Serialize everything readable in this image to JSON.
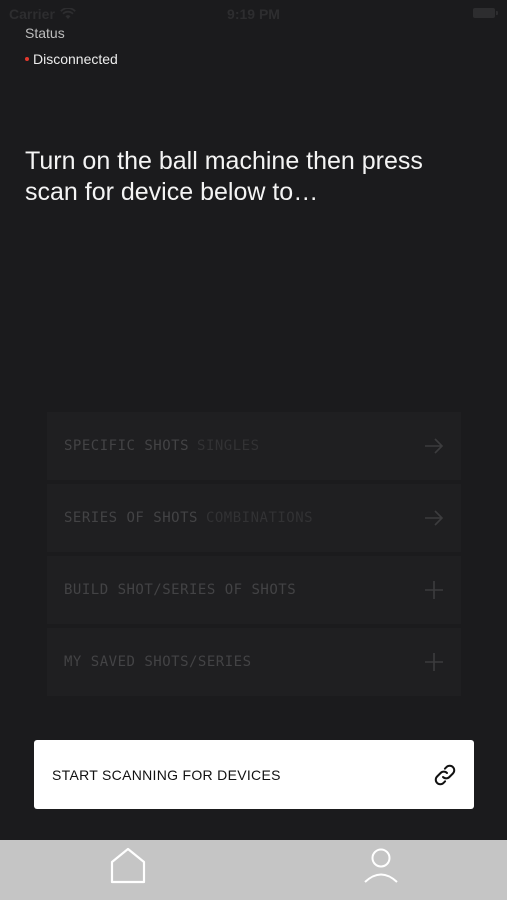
{
  "status_bar": {
    "carrier": "Carrier",
    "time": "9:19 PM"
  },
  "connection": {
    "label": "Status",
    "state": "Disconnected",
    "state_color": "#e3382d"
  },
  "headline": "Turn on the ball machine then press scan for device below to…",
  "menu": {
    "items": [
      {
        "label": "SPECIFIC SHOTS",
        "sub": "SINGLES",
        "icon": "arrow-right-icon"
      },
      {
        "label": "SERIES OF SHOTS",
        "sub": "COMBINATIONS",
        "icon": "arrow-right-icon"
      },
      {
        "label": "BUILD SHOT/SERIES OF SHOTS",
        "sub": "",
        "icon": "plus-icon"
      },
      {
        "label": "MY SAVED SHOTS/SERIES",
        "sub": "",
        "icon": "plus-icon"
      }
    ]
  },
  "scan_button": {
    "label": "START SCANNING FOR DEVICES",
    "icon": "link-icon"
  },
  "tab_bar": {
    "tabs": [
      {
        "name": "home",
        "icon": "home-icon"
      },
      {
        "name": "profile",
        "icon": "user-icon"
      }
    ]
  }
}
